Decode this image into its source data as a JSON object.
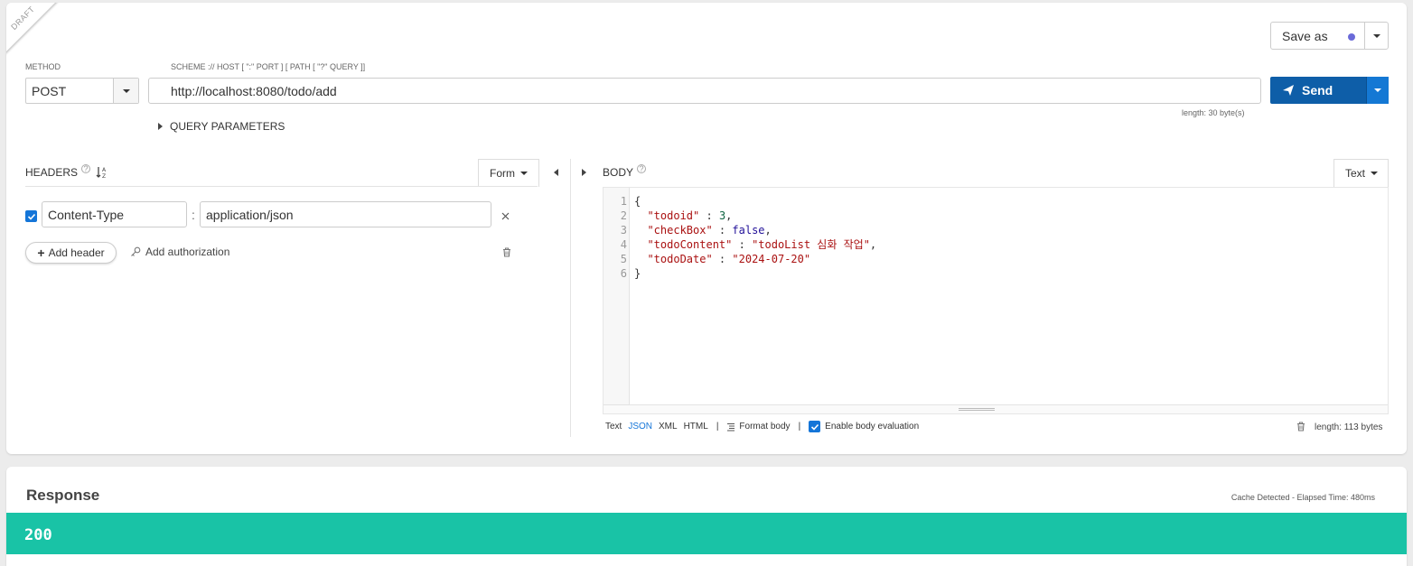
{
  "ribbon": {
    "label": "DRAFT"
  },
  "request": {
    "method_label": "METHOD",
    "method_value": "POST",
    "url_label": "SCHEME :// HOST [ \":\" PORT ] [ PATH [ \"?\" QUERY ]]",
    "url_value": "http://localhost:8080/todo/add",
    "url_length": "length: 30 byte(s)",
    "save_as_label": "Save as",
    "send_label": "Send",
    "query_params_label": "QUERY PARAMETERS"
  },
  "headers": {
    "title": "HEADERS",
    "mode_label": "Form",
    "items": [
      {
        "enabled": true,
        "name": "Content-Type",
        "separator": ":",
        "value": "application/json"
      }
    ],
    "add_header_label": "Add header",
    "add_auth_label": "Add authorization"
  },
  "body": {
    "title": "BODY",
    "mode_label": "Text",
    "lines": [
      {
        "n": "1",
        "text": "{"
      },
      {
        "n": "2",
        "key": "\"todoid\"",
        "sep": " : ",
        "val": "3",
        "val_type": "num",
        "tail": ","
      },
      {
        "n": "3",
        "key": "\"checkBox\"",
        "sep": " : ",
        "val": "false",
        "val_type": "kw",
        "tail": ","
      },
      {
        "n": "4",
        "key": "\"todoContent\"",
        "sep": " : ",
        "val": "\"todoList 심화 작업\"",
        "val_type": "str",
        "tail": ","
      },
      {
        "n": "5",
        "key": "\"todoDate\"",
        "sep": " : ",
        "val": "\"2024-07-20\"",
        "val_type": "str",
        "tail": ""
      },
      {
        "n": "6",
        "text": "}"
      }
    ],
    "formats": [
      "Text",
      "JSON",
      "XML",
      "HTML"
    ],
    "active_format": "JSON",
    "format_body_label": "Format body",
    "enable_eval_label": "Enable body evaluation",
    "enable_eval_checked": true,
    "length": "length: 113 bytes",
    "pipe": "|"
  },
  "response": {
    "title": "Response",
    "meta": "Cache Detected - Elapsed Time: 480ms",
    "status_code": "200",
    "status_color": "#19c3a6"
  },
  "colors": {
    "primary": "#0e5ea8",
    "accent": "#1475d8",
    "success": "#19c3a6"
  }
}
